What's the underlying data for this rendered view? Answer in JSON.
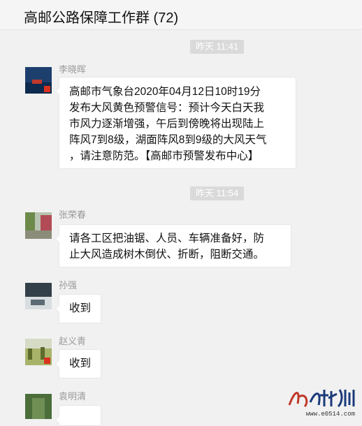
{
  "header": {
    "title": "高邮公路保障工作群 (72)"
  },
  "messages": [
    {
      "time": "昨天 11:41",
      "sender": "李晓晖",
      "text": [
        "高邮市气象台2020年04月12日10时19分",
        "发布大风黄色预警信号：预计今天白天我",
        "市风力逐渐增强，午后到傍晚将出现陆上",
        "阵风7到8级，湖面阵风8到9级的大风天气",
        "，请注意防范。【高邮市预警发布中心】"
      ]
    },
    {
      "time": "昨天 11:54",
      "sender": "张荣春",
      "text": [
        "请各工区把油锯、人员、车辆准备好，防",
        "止大风造成树木倒伏、折断，阻断交通。"
      ]
    },
    {
      "sender": "孙强",
      "text": [
        "收到"
      ]
    },
    {
      "sender": "赵义青",
      "text": [
        "收到"
      ]
    },
    {
      "sender": "袁明清"
    }
  ],
  "watermark": {
    "url": "www.e0514.com"
  }
}
